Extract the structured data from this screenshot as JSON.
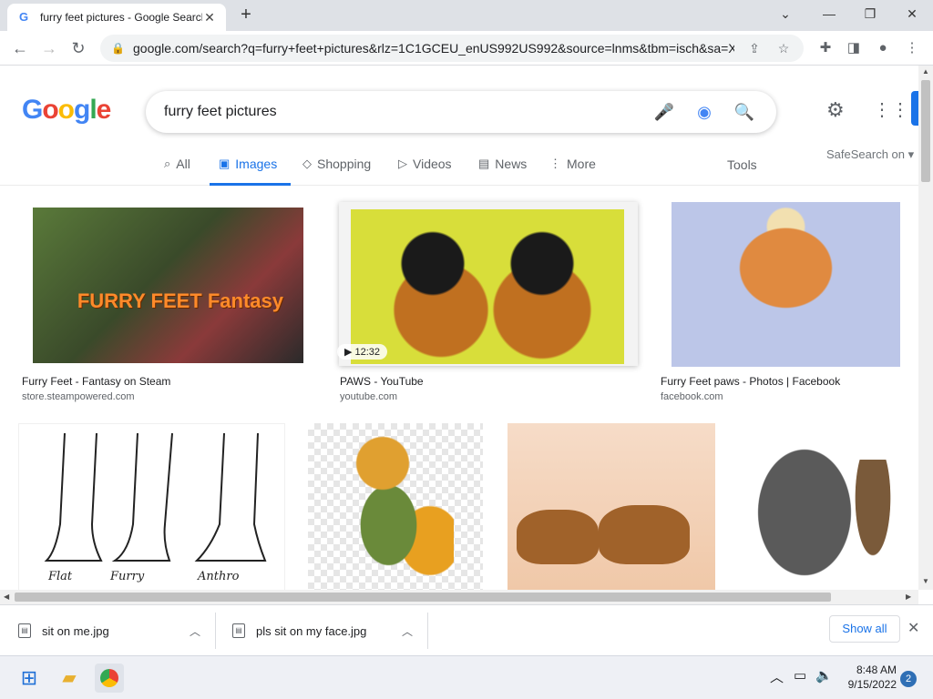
{
  "browser": {
    "tab_title": "furry feet pictures - Google Search",
    "tab_favicon": "G",
    "url": "google.com/search?q=furry+feet+pictures&rlz=1C1GCEU_enUS992US992&source=lnms&tbm=isch&sa=X..."
  },
  "search": {
    "logo": "Google",
    "query": "furry feet pictures",
    "safesearch": "SafeSearch on",
    "tools": "Tools",
    "tabs": [
      {
        "label": "All",
        "icon": "search-icon"
      },
      {
        "label": "Images",
        "icon": "image-icon"
      },
      {
        "label": "Shopping",
        "icon": "tag-icon"
      },
      {
        "label": "Videos",
        "icon": "play-icon"
      },
      {
        "label": "News",
        "icon": "news-icon"
      },
      {
        "label": "More",
        "icon": "more-vert-icon"
      }
    ]
  },
  "results": [
    {
      "title": "Furry Feet - Fantasy on Steam",
      "source": "store.steampowered.com",
      "overlay": "FURRY FEET Fantasy"
    },
    {
      "title": "PAWS - YouTube",
      "source": "youtube.com",
      "duration": "12:32"
    },
    {
      "title": "Furry Feet paws - Photos | Facebook",
      "source": "facebook.com"
    },
    {
      "title": "",
      "source": "",
      "labels": [
        "Flat",
        "Furry",
        "Anthro"
      ]
    },
    {
      "title": "",
      "source": ""
    },
    {
      "title": "",
      "source": ""
    },
    {
      "title": "",
      "source": ""
    }
  ],
  "downloads": {
    "items": [
      {
        "name": "sit on me.jpg"
      },
      {
        "name": "pls sit on my face.jpg"
      }
    ],
    "show_all": "Show all"
  },
  "taskbar": {
    "time": "8:48 AM",
    "date": "9/15/2022",
    "notifications": "2"
  },
  "colors": {
    "accent": "#1a73e8",
    "g_blue": "#4285f4",
    "g_red": "#ea4335",
    "g_yellow": "#fbbc05",
    "g_green": "#34a853"
  }
}
